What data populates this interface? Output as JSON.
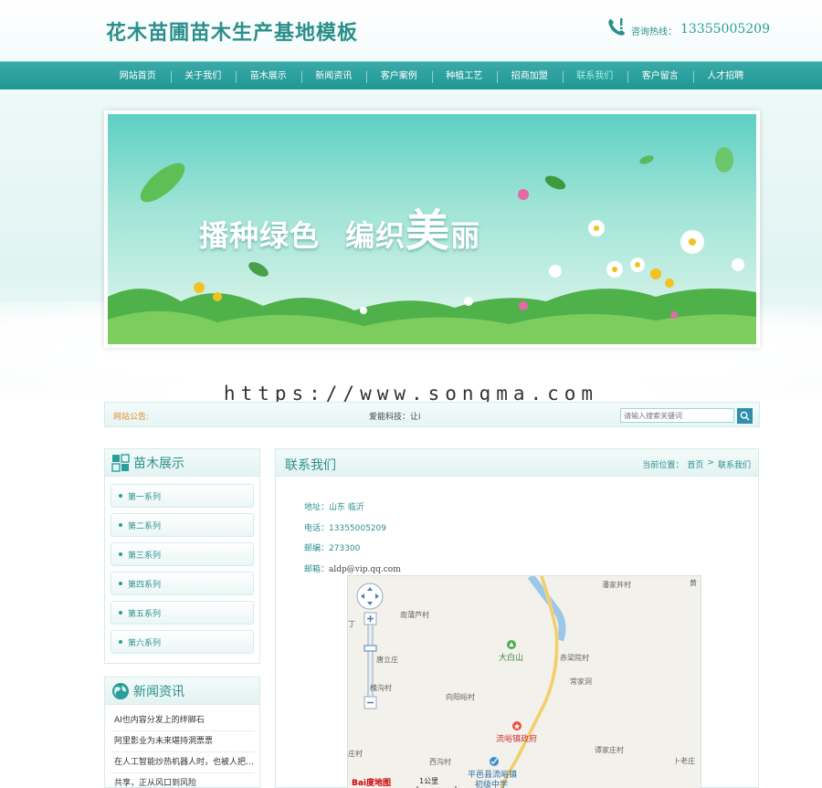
{
  "header": {
    "logo": "花木苗圃苗木生产基地模板",
    "hotline_label": "咨询热线：",
    "hotline_number": "13355005209"
  },
  "nav": {
    "items": [
      "网站首页",
      "关于我们",
      "苗木展示",
      "新闻资讯",
      "客户案例",
      "种植工艺",
      "招商加盟",
      "联系我们",
      "客户留言",
      "人才招聘"
    ],
    "active_index": 7
  },
  "banner": {
    "slogan_part1": "播种绿色",
    "slogan_part2": "编织",
    "slogan_big": "美",
    "slogan_part3": "丽"
  },
  "watermark": "https://www.songma.com",
  "notice": {
    "label": "网站公告:",
    "text": "爱能科技：让i",
    "search_placeholder": "请输入搜索关键词"
  },
  "products": {
    "title": "苗木展示",
    "items": [
      "第一系列",
      "第二系列",
      "第三系列",
      "第四系列",
      "第五系列",
      "第六系列"
    ]
  },
  "news": {
    "title": "新闻资讯",
    "items": [
      "AI也内容分发上的绊脚石",
      "阿里影业为未来堪持洞票票",
      "在人工智能炒热机器人时，也被人把…",
      "共享，正从风口到风险"
    ]
  },
  "main": {
    "title": "联系我们",
    "crumb_label": "当前位置：",
    "crumb_home": "首页",
    "crumb_sep": ">",
    "crumb_current": "联系我们"
  },
  "contact": {
    "address_label": "地址：",
    "address": "山东 临沂",
    "phone_label": "电话：",
    "phone": "13355005209",
    "zip_label": "邮编：",
    "zip": "273300",
    "email_label": "邮箱：",
    "email": "aldp@vip.qq.com"
  },
  "map": {
    "labels": {
      "l1": "潘家井村",
      "l2": "黄",
      "l3": "南蒲芦村",
      "l4": "大白山",
      "l5": "赤梁院村",
      "l6": "唐立庄",
      "l7": "常家洞",
      "l8": "槐沟村",
      "l9": "向阳峪村",
      "l10": "流峪镇政府",
      "l11": "谭家庄村",
      "l12": "庄村",
      "l13": "西沟村",
      "l14": "平邑县流峪镇",
      "l15": "初级中学",
      "l16": "卜老庄",
      "l17": "丁",
      "scale": "1公里"
    },
    "logo": "Bai度地图"
  }
}
